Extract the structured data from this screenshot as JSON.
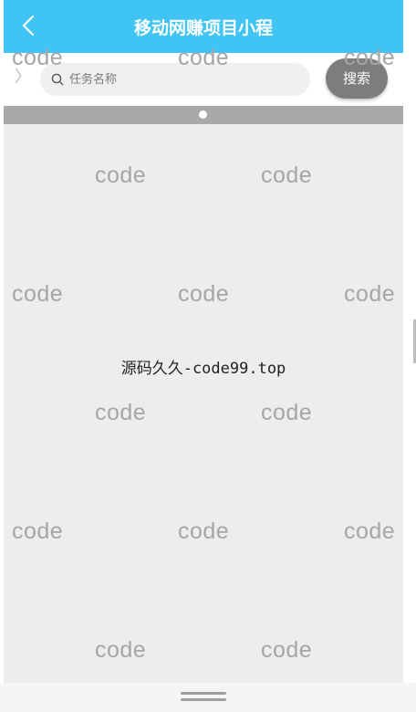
{
  "navbar": {
    "title": "移动网赚项目小程",
    "back_icon": "chevron-left-icon",
    "background": "#40c4f3"
  },
  "search": {
    "side_arrow": "〉",
    "placeholder": "任务名称",
    "value": "",
    "button_label": "搜索",
    "search_icon": "search-icon"
  },
  "banner": {
    "background": "#a9a9a9",
    "dots": 1
  },
  "main": {
    "center_text": "源码久久-code99.top"
  },
  "watermarks": [
    "code",
    "code",
    "code",
    "code",
    "code",
    "code",
    "code",
    "code",
    "code",
    "code",
    "code",
    "code",
    "code",
    "code",
    "code",
    "code",
    "code",
    "code"
  ]
}
